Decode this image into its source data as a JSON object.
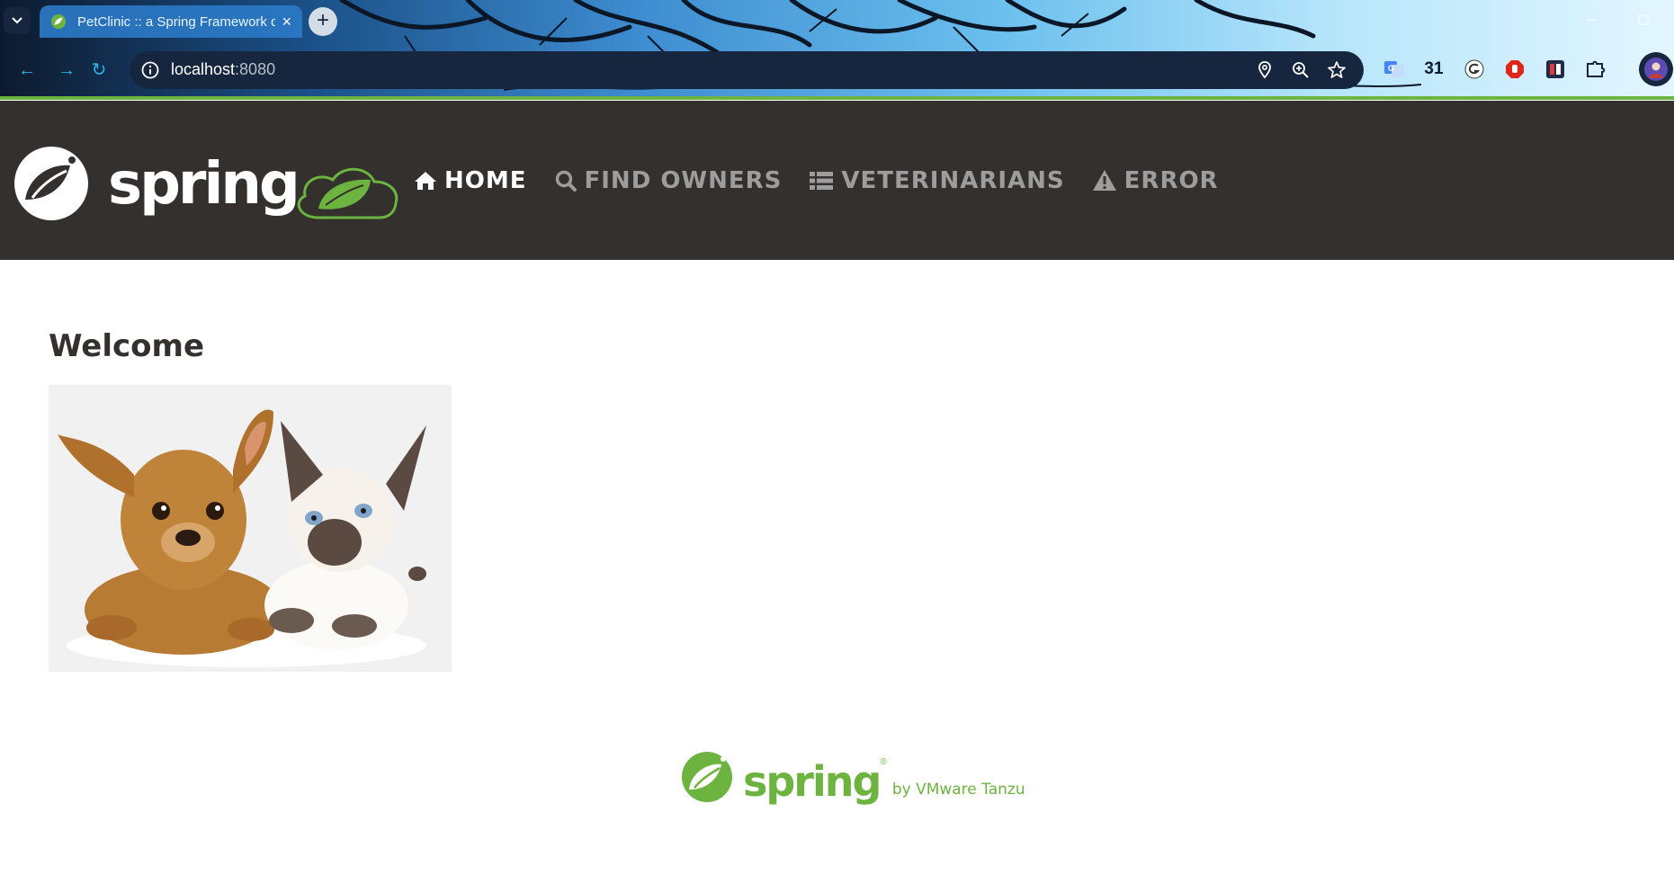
{
  "browser": {
    "tab_title": "PetClinic :: a Spring Framework demonstration",
    "new_tab_symbol": "+",
    "close_tab_symbol": "×",
    "url_host": "localhost",
    "url_port": ":8080",
    "extensions": [
      {
        "name": "translate-icon"
      },
      {
        "name": "calendar-icon",
        "text": "31"
      },
      {
        "name": "grammarly-icon"
      },
      {
        "name": "adblock-icon"
      },
      {
        "name": "extension-app-icon"
      },
      {
        "name": "puzzle-icon"
      }
    ],
    "colors": {
      "accent": "#2b78c4",
      "toolbar": "#16263e"
    }
  },
  "navbar": {
    "brand": "spring",
    "items": [
      {
        "label": "HOME",
        "icon": "home-icon",
        "active": true
      },
      {
        "label": "FIND OWNERS",
        "icon": "search-icon",
        "active": false
      },
      {
        "label": "VETERINARIANS",
        "icon": "list-icon",
        "active": false
      },
      {
        "label": "ERROR",
        "icon": "warning-icon",
        "active": false
      }
    ],
    "colors": {
      "background": "#34302d",
      "active": "#ffffff",
      "inactive": "#9d9d9d",
      "spring_green": "#6db33f"
    }
  },
  "main": {
    "heading": "Welcome",
    "image_alt": "pets"
  },
  "footer": {
    "brand": "spring",
    "registered": "®",
    "tagline": "by VMware Tanzu"
  }
}
